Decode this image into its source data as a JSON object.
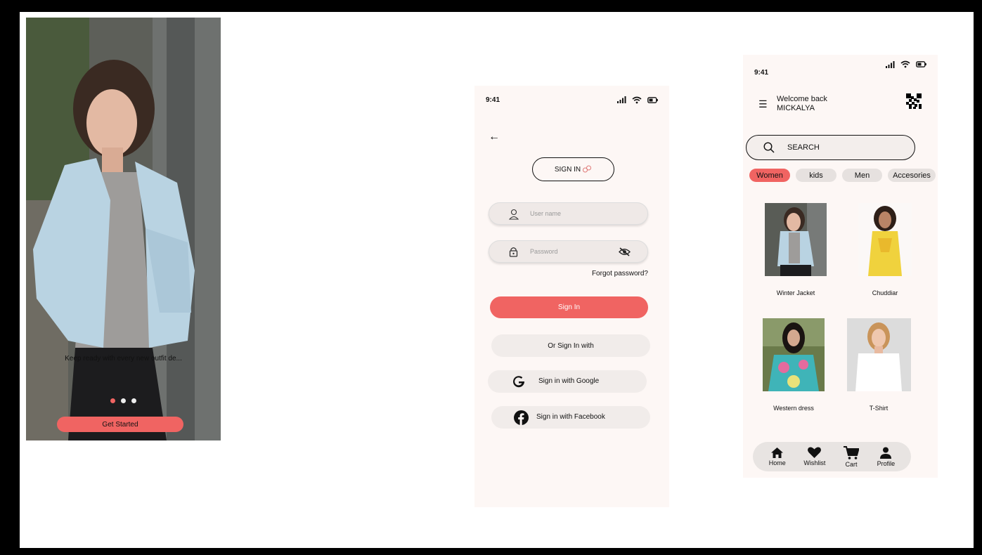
{
  "onboarding": {
    "tagline": "Keep ready with every new outfit de...",
    "get_started_label": "Get Started"
  },
  "signin": {
    "time": "9:41",
    "title": "SIGN IN",
    "username_placeholder": "User name",
    "password_placeholder": "Password",
    "forgot_label": "Forgot password?",
    "signin_button": "Sign In",
    "or_label": "Or Sign In with",
    "google_label": "Sign in with Google",
    "facebook_label": "Sign in with Facebook"
  },
  "home": {
    "time": "9:41",
    "welcome_line1": "Welcome back",
    "welcome_line2": "MICKALYA",
    "search_label": "SEARCH",
    "categories": [
      "Women",
      "kids",
      "Men",
      "Accesories"
    ],
    "products": [
      {
        "name": "Winter Jacket"
      },
      {
        "name": "Chuddiar"
      },
      {
        "name": "Western dress"
      },
      {
        "name": "T-Shirt"
      }
    ],
    "nav": [
      "Home",
      "Wishlist",
      "Cart",
      "Profile"
    ]
  },
  "colors": {
    "accent": "#f06462",
    "background": "#fdf7f5"
  }
}
